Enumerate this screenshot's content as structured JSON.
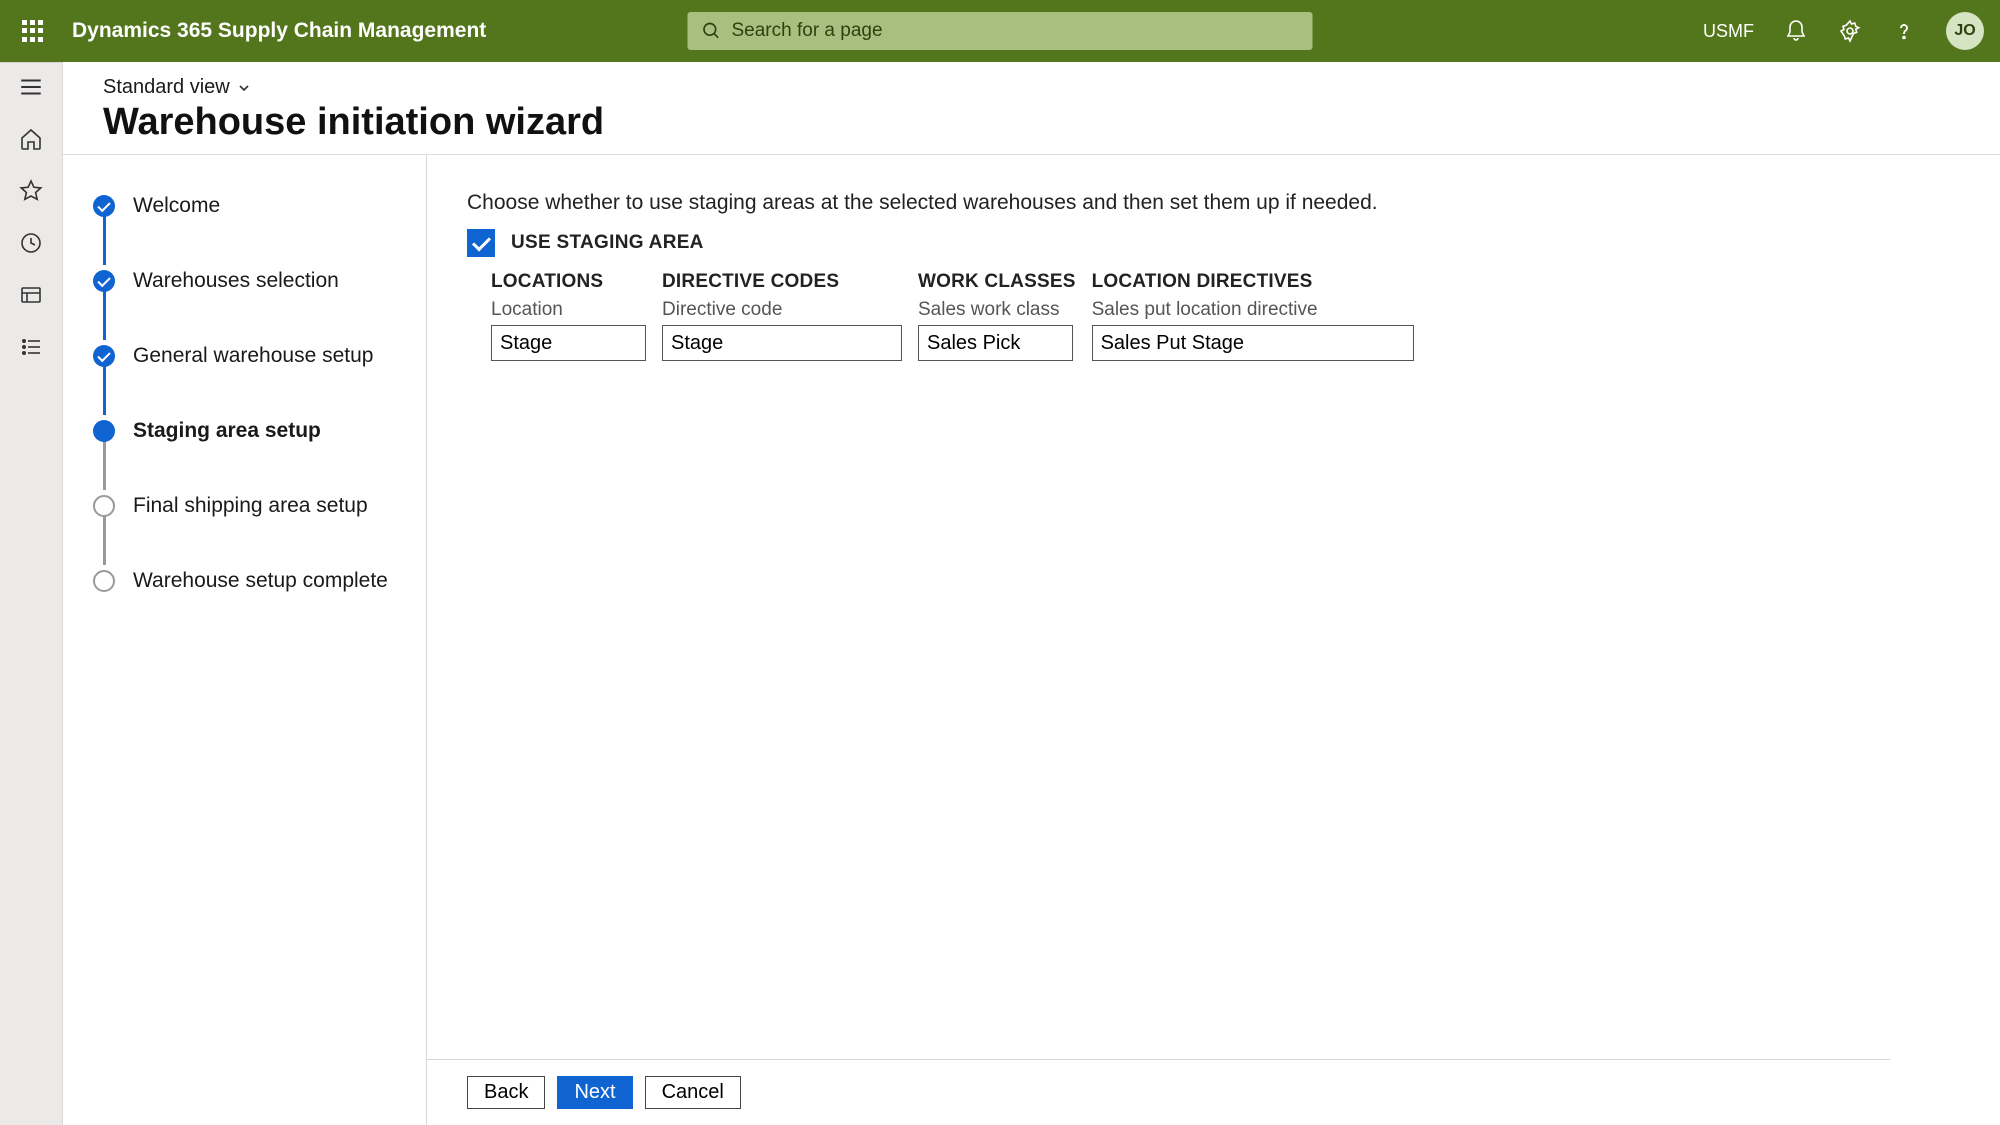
{
  "header": {
    "app_name": "Dynamics 365 Supply Chain Management",
    "search_placeholder": "Search for a page",
    "entity": "USMF",
    "avatar_initials": "JO"
  },
  "page": {
    "view_label": "Standard view",
    "title": "Warehouse initiation wizard"
  },
  "steps": [
    {
      "label": "Welcome",
      "state": "done"
    },
    {
      "label": "Warehouses selection",
      "state": "done"
    },
    {
      "label": "General warehouse setup",
      "state": "done"
    },
    {
      "label": "Staging area setup",
      "state": "current"
    },
    {
      "label": "Final shipping area setup",
      "state": "todo"
    },
    {
      "label": "Warehouse setup complete",
      "state": "todo"
    }
  ],
  "wizard": {
    "instruction": "Choose whether to use staging areas at the selected warehouses and then set them up if needed.",
    "checkbox_label": "USE STAGING AREA",
    "checkbox_checked": true,
    "columns": {
      "locations": {
        "header": "LOCATIONS",
        "field_label": "Location",
        "value": "Stage"
      },
      "directive_codes": {
        "header": "DIRECTIVE CODES",
        "field_label": "Directive code",
        "value": "Stage"
      },
      "work_classes": {
        "header": "WORK CLASSES",
        "field_label": "Sales work class",
        "value": "Sales Pick"
      },
      "location_directives": {
        "header": "LOCATION DIRECTIVES",
        "field_label": "Sales put location directive",
        "value": "Sales Put Stage"
      }
    }
  },
  "footer": {
    "back": "Back",
    "next": "Next",
    "cancel": "Cancel"
  }
}
